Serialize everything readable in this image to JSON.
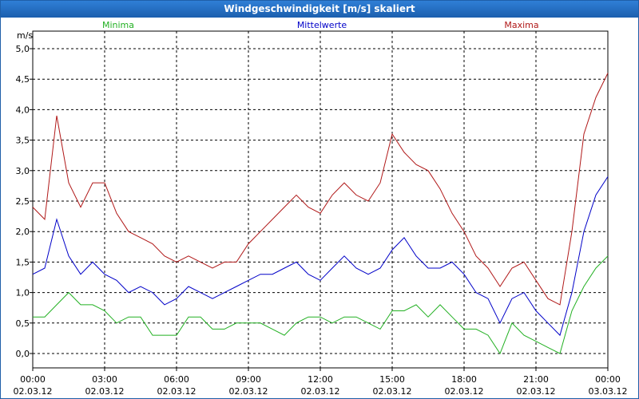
{
  "window": {
    "title": "Windgeschwindigkeit [m/s] skaliert"
  },
  "chart_data": {
    "type": "line",
    "ylabel": "m/s",
    "ylim": [
      0,
      5
    ],
    "y_ticks": [
      {
        "v": 0.0,
        "label": "0,0"
      },
      {
        "v": 0.5,
        "label": "0,5"
      },
      {
        "v": 1.0,
        "label": "1,0"
      },
      {
        "v": 1.5,
        "label": "1,5"
      },
      {
        "v": 2.0,
        "label": "2,0"
      },
      {
        "v": 2.5,
        "label": "2,5"
      },
      {
        "v": 3.0,
        "label": "3,0"
      },
      {
        "v": 3.5,
        "label": "3,5"
      },
      {
        "v": 4.0,
        "label": "4,0"
      },
      {
        "v": 4.5,
        "label": "4,5"
      },
      {
        "v": 5.0,
        "label": "5,0"
      }
    ],
    "x_ticks": [
      {
        "time": "00:00",
        "date": "02.03.12"
      },
      {
        "time": "03:00",
        "date": "02.03.12"
      },
      {
        "time": "06:00",
        "date": "02.03.12"
      },
      {
        "time": "09:00",
        "date": "02.03.12"
      },
      {
        "time": "12:00",
        "date": "02.03.12"
      },
      {
        "time": "15:00",
        "date": "02.03.12"
      },
      {
        "time": "18:00",
        "date": "02.03.12"
      },
      {
        "time": "21:00",
        "date": "02.03.12"
      },
      {
        "time": "00:00",
        "date": "03.03.12"
      }
    ],
    "grid": true,
    "legend_position": "top",
    "x_hours_start": 0,
    "x_hours_end": 24,
    "series": [
      {
        "name": "Minima",
        "color": "#22b022",
        "x": [
          0,
          0.5,
          1,
          1.5,
          2,
          2.5,
          3,
          3.5,
          4,
          4.5,
          5,
          5.5,
          6,
          6.5,
          7,
          7.5,
          8,
          8.5,
          9,
          9.5,
          10,
          10.5,
          11,
          11.5,
          12,
          12.5,
          13,
          13.5,
          14,
          14.5,
          15,
          15.5,
          16,
          16.5,
          17,
          17.5,
          18,
          18.5,
          19,
          19.5,
          20,
          20.5,
          21,
          21.5,
          22,
          22.5,
          23,
          23.5,
          24
        ],
        "values": [
          0.6,
          0.6,
          0.8,
          1.0,
          0.8,
          0.8,
          0.7,
          0.5,
          0.6,
          0.6,
          0.3,
          0.3,
          0.3,
          0.6,
          0.6,
          0.4,
          0.4,
          0.5,
          0.5,
          0.5,
          0.4,
          0.3,
          0.5,
          0.6,
          0.6,
          0.5,
          0.6,
          0.6,
          0.5,
          0.4,
          0.7,
          0.7,
          0.8,
          0.6,
          0.8,
          0.6,
          0.4,
          0.4,
          0.3,
          0.0,
          0.5,
          0.3,
          0.2,
          0.1,
          0.0,
          0.7,
          1.1,
          1.4,
          1.6
        ]
      },
      {
        "name": "Mittelwerte",
        "color": "#0000c8",
        "x": [
          0,
          0.5,
          1,
          1.5,
          2,
          2.5,
          3,
          3.5,
          4,
          4.5,
          5,
          5.5,
          6,
          6.5,
          7,
          7.5,
          8,
          8.5,
          9,
          9.5,
          10,
          10.5,
          11,
          11.5,
          12,
          12.5,
          13,
          13.5,
          14,
          14.5,
          15,
          15.5,
          16,
          16.5,
          17,
          17.5,
          18,
          18.5,
          19,
          19.5,
          20,
          20.5,
          21,
          21.5,
          22,
          22.5,
          23,
          23.5,
          24
        ],
        "values": [
          1.3,
          1.4,
          2.2,
          1.6,
          1.3,
          1.5,
          1.3,
          1.2,
          1.0,
          1.1,
          1.0,
          0.8,
          0.9,
          1.1,
          1.0,
          0.9,
          1.0,
          1.1,
          1.2,
          1.3,
          1.3,
          1.4,
          1.5,
          1.3,
          1.2,
          1.4,
          1.6,
          1.4,
          1.3,
          1.4,
          1.7,
          1.9,
          1.6,
          1.4,
          1.4,
          1.5,
          1.3,
          1.0,
          0.9,
          0.5,
          0.9,
          1.0,
          0.7,
          0.5,
          0.3,
          1.0,
          2.0,
          2.6,
          2.9
        ]
      },
      {
        "name": "Maxima",
        "color": "#b01818",
        "x": [
          0,
          0.5,
          1,
          1.5,
          2,
          2.5,
          3,
          3.5,
          4,
          4.5,
          5,
          5.5,
          6,
          6.5,
          7,
          7.5,
          8,
          8.5,
          9,
          9.5,
          10,
          10.5,
          11,
          11.5,
          12,
          12.5,
          13,
          13.5,
          14,
          14.5,
          15,
          15.5,
          16,
          16.5,
          17,
          17.5,
          18,
          18.5,
          19,
          19.5,
          20,
          20.5,
          21,
          21.5,
          22,
          22.5,
          23,
          23.5,
          24
        ],
        "values": [
          2.4,
          2.2,
          3.9,
          2.8,
          2.4,
          2.8,
          2.8,
          2.3,
          2.0,
          1.9,
          1.8,
          1.6,
          1.5,
          1.6,
          1.5,
          1.4,
          1.5,
          1.5,
          1.8,
          2.0,
          2.2,
          2.4,
          2.6,
          2.4,
          2.3,
          2.6,
          2.8,
          2.6,
          2.5,
          2.8,
          3.6,
          3.3,
          3.1,
          3.0,
          2.7,
          2.3,
          2.0,
          1.6,
          1.4,
          1.1,
          1.4,
          1.5,
          1.2,
          0.9,
          0.8,
          2.0,
          3.6,
          4.2,
          4.6
        ]
      }
    ]
  }
}
